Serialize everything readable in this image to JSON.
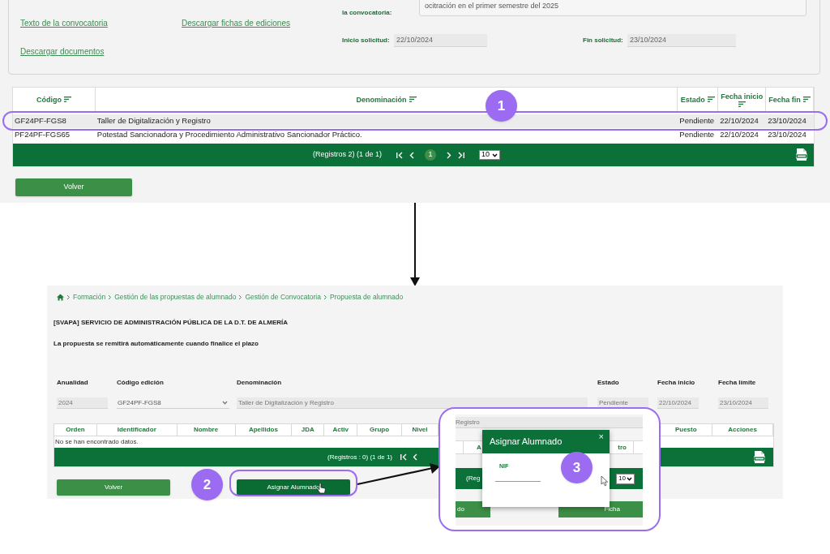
{
  "top_screen": {
    "description": {
      "label": "la convocatoria:",
      "value": "ocitración en el primer semestre del 2025"
    },
    "links": [
      {
        "label": "Texto de la convocatoria"
      },
      {
        "label": "Descargar fichas de ediciones"
      },
      {
        "label": "Descargar documentos"
      }
    ],
    "dates": [
      {
        "label": "Inicio solicitud:",
        "value": "22/10/2024"
      },
      {
        "label": "Fin solicitud:",
        "value": "23/10/2024"
      }
    ],
    "table": {
      "columns": [
        {
          "label": "Código",
          "sortable": true
        },
        {
          "label": "Denominación",
          "sortable": true
        },
        {
          "label": "Estado",
          "sortable": true
        },
        {
          "label": "Fecha inicio",
          "sortable": true
        },
        {
          "label": "Fecha fin",
          "sortable": true
        }
      ],
      "rows": [
        {
          "cells": [
            "GF24PF-FGS8",
            "Taller de Digitalización y Registro",
            "Pendiente",
            "22/10/2024",
            "23/10/2024"
          ],
          "selected": true
        },
        {
          "cells": [
            "PF24PF-FGS65",
            "Potestad Sancionadora y Procedimiento Administrativo Sancionador Práctico.",
            "Pendiente",
            "22/10/2024",
            "23/10/2024"
          ],
          "selected": false
        }
      ]
    },
    "pagination": {
      "summary": "(Registros 2) (1 de 1)",
      "current_page": "1",
      "page_size": "10"
    },
    "buttons": [
      {
        "label": "Volver"
      }
    ]
  },
  "bottom_screen": {
    "breadcrumb": [
      "Formación",
      "Gestión de las propuestas de alumnado",
      "Gestión de Convocatoria",
      "Propuesta de alumnado"
    ],
    "heading": "[SVAPA] SERVICIO DE ADMINISTRACIÓN PÚBLICA DE LA D.T. DE ALMERÍA",
    "notice": "La propuesta se remitirá automáticamente cuando finalice el plazo",
    "fields": [
      {
        "label": "Anualidad",
        "value": "2024",
        "kind": "text"
      },
      {
        "label": "Código edición",
        "value": "GF24PF-FGS8",
        "kind": "select"
      },
      {
        "label": "Denominación",
        "value": "Taller de Digitalización y Registro",
        "kind": "text"
      },
      {
        "label": "Estado",
        "value": "Pendiente",
        "kind": "text"
      },
      {
        "label": "Fecha inicio",
        "value": "22/10/2024",
        "kind": "text"
      },
      {
        "label": "Fecha límite",
        "value": "23/10/2024",
        "kind": "text"
      }
    ],
    "table": {
      "columns": [
        "Orden",
        "Identificador",
        "Nombre",
        "Apellidos",
        "JDA",
        "Activ",
        "Grupo",
        "Nivel",
        "Puesto",
        "Acciones"
      ],
      "empty_message": "No se han encontrado datos."
    },
    "pagination": {
      "summary": "(Registros : 0) (1 de 1)"
    },
    "buttons": [
      {
        "label": "Volver",
        "hovered": false
      },
      {
        "label": "Asignar Alumnado",
        "hovered": true
      }
    ]
  },
  "inset": {
    "field_value": "Registro",
    "header_cells": [
      "A",
      "tro"
    ],
    "pagination_summary": "(Reg",
    "page_size": "10",
    "buttons": [
      "do",
      "Ficha"
    ],
    "modal": {
      "title": "Asignar Alumnado",
      "close": "×",
      "field_label": "NIF"
    }
  },
  "steps": [
    {
      "number": "1"
    },
    {
      "number": "2"
    },
    {
      "number": "3"
    }
  ]
}
